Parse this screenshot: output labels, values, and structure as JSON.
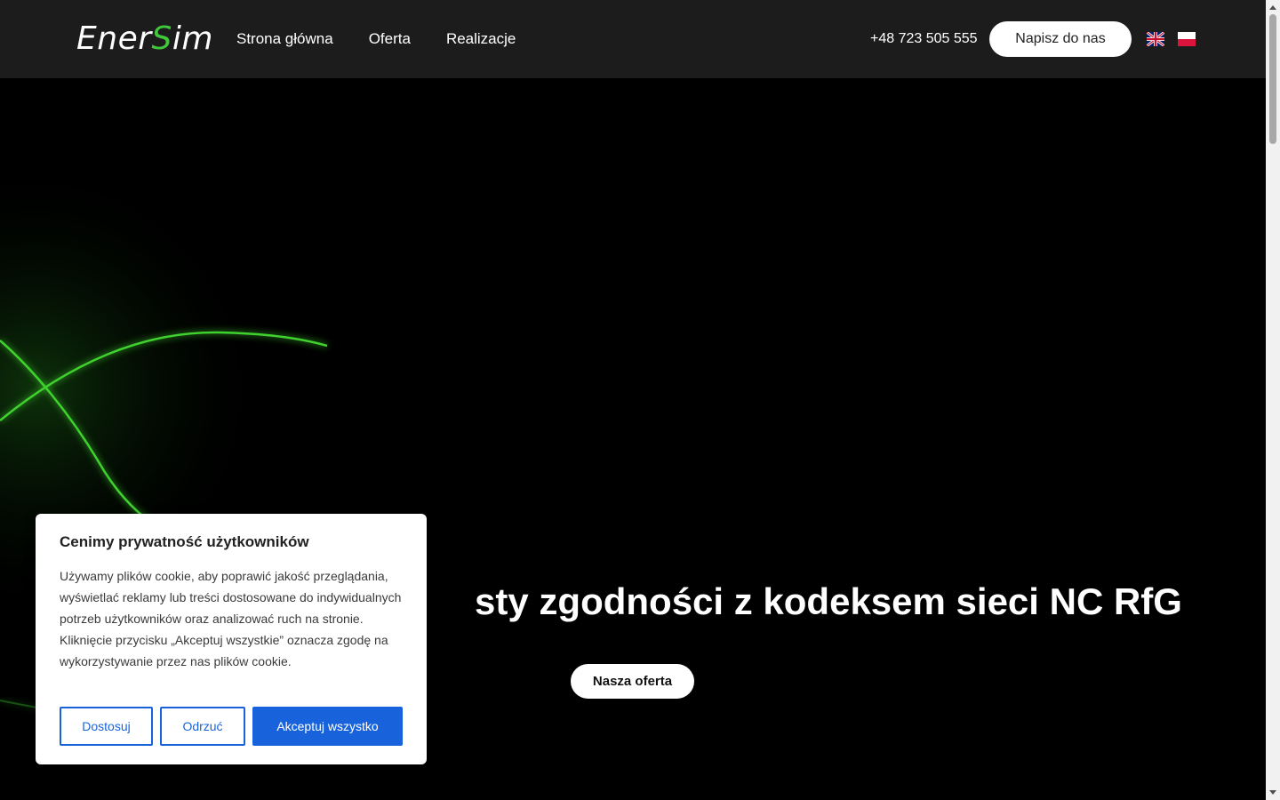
{
  "header": {
    "logo_prefix": "Ener",
    "logo_s": "S",
    "logo_suffix": "im",
    "nav": [
      {
        "label": "Strona główna"
      },
      {
        "label": "Oferta"
      },
      {
        "label": "Realizacje"
      }
    ],
    "phone": "+48 723 505 555",
    "contact_button": "Napisz do nas",
    "languages": [
      "en-flag-icon",
      "pl-flag-icon"
    ]
  },
  "hero": {
    "title": "sty zgodności z kodeksem sieci NC RfG",
    "button": "Nasza oferta"
  },
  "cookie_banner": {
    "title": "Cenimy prywatność użytkowników",
    "text": "Używamy plików cookie, aby poprawić jakość przeglądania, wyświetlać reklamy lub treści dostosowane do indywidualnych potrzeb użytkowników oraz analizować ruch na stronie. Kliknięcie przycisku „Akceptuj wszystkie” oznacza zgodę na wykorzystywanie przez nas plików cookie.",
    "customize": "Dostosuj",
    "reject": "Odrzuć",
    "accept": "Akceptuj wszystko"
  },
  "colors": {
    "accent_green": "#3fc93a",
    "cookie_blue": "#1863dc",
    "header_bg": "#1c1c1c"
  }
}
